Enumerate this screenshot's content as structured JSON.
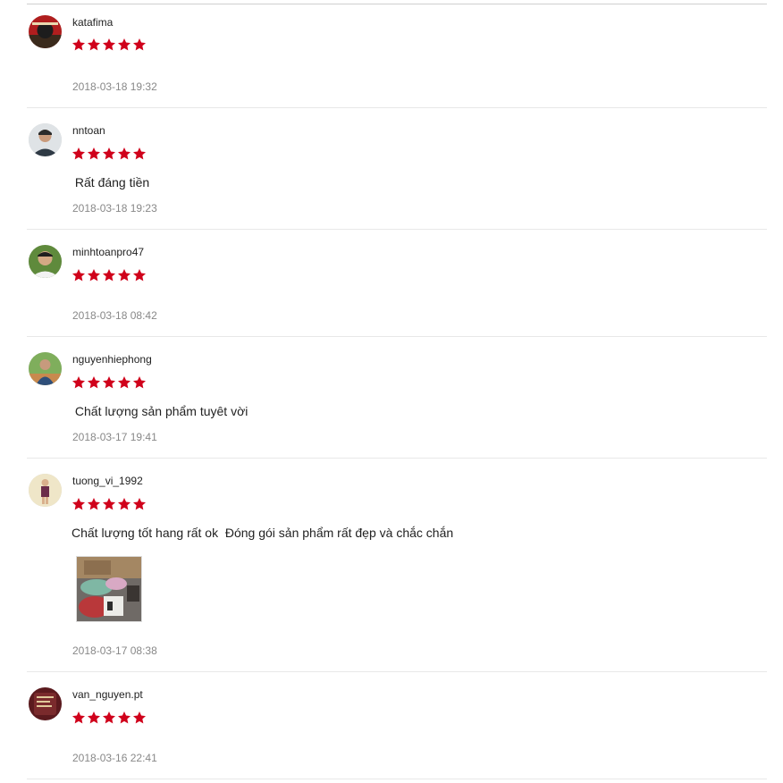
{
  "colors": {
    "star": "#d0011b",
    "date": "#888888",
    "divider": "#e8e8e8"
  },
  "reviews": [
    {
      "username": "katafima",
      "rating": 5,
      "comment": "",
      "date": "2018-03-18 19:32"
    },
    {
      "username": "nntoan",
      "rating": 5,
      "comment": " Rất đáng tiền",
      "date": "2018-03-18 19:23"
    },
    {
      "username": "minhtoanpro47",
      "rating": 5,
      "comment": "",
      "date": "2018-03-18 08:42"
    },
    {
      "username": "nguyenhiephong",
      "rating": 5,
      "comment": " Chất lượng sản phẩm tuyêt vời",
      "date": "2018-03-17 19:41"
    },
    {
      "username": "tuong_vi_1992",
      "rating": 5,
      "comment": "Chất lượng tốt hang rất ok  Đóng gói sản phẩm rất đẹp và chắc chắn",
      "date": "2018-03-17 08:38",
      "photo_icon": "product-photo-thumbnail"
    },
    {
      "username": "van_nguyen.pt",
      "rating": 5,
      "comment": "",
      "date": "2018-03-16 22:41"
    }
  ]
}
